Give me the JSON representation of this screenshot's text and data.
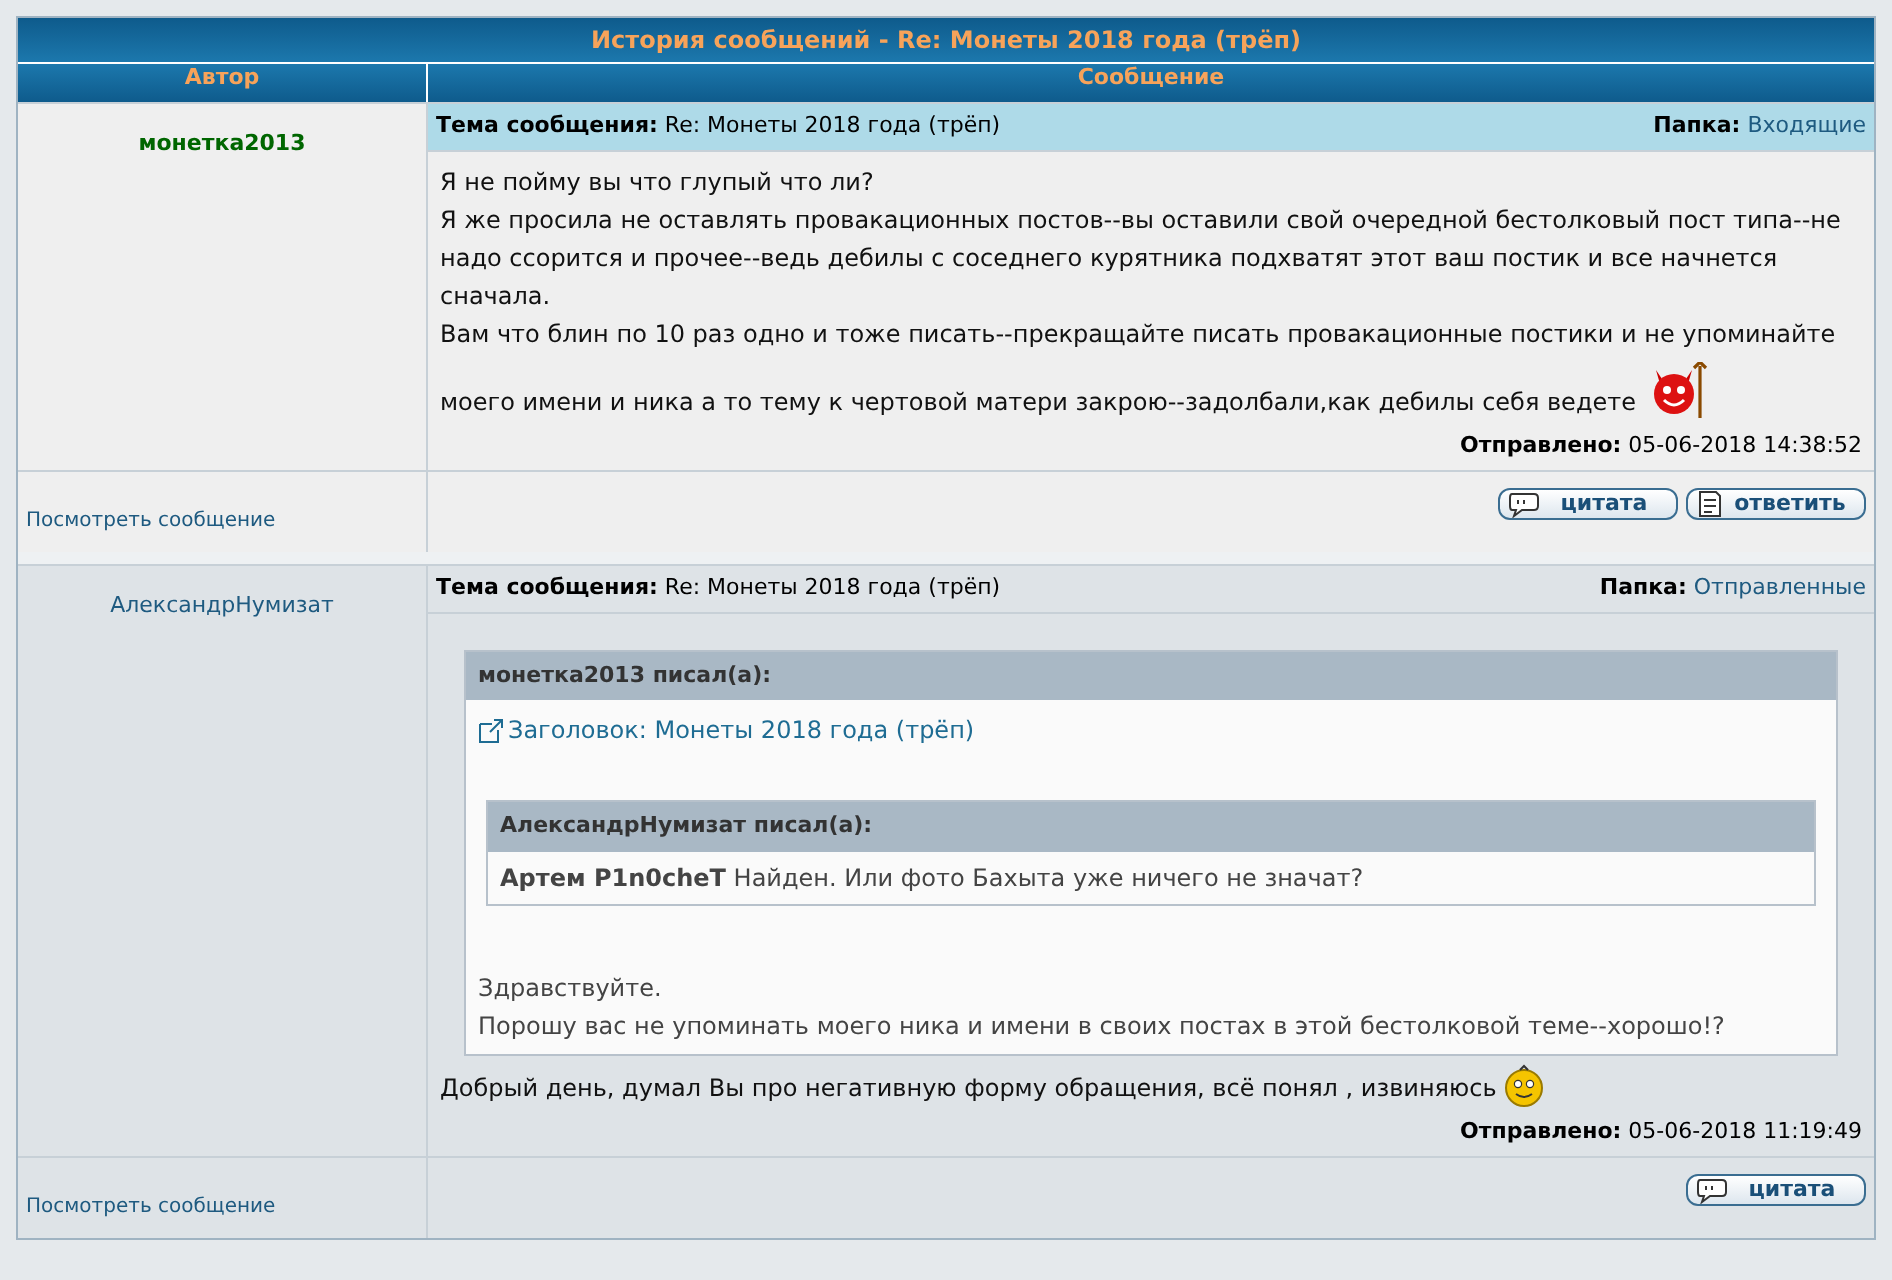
{
  "page": {
    "title": "История сообщений - Re: Монеты 2018 года (трёп)"
  },
  "columns": [
    "Автор",
    "Сообщение"
  ],
  "posts": [
    {
      "author": "монетка2013",
      "highlighted": true,
      "subject_label": "Тема сообщения:",
      "subject": "Re: Монеты 2018 года (трёп)",
      "folder_label": "Папка:",
      "folder": "Входящие",
      "body": [
        {
          "kind": "text",
          "text": "Я не пойму вы что глупый что ли?"
        },
        {
          "kind": "text",
          "text": "Я же просила не оставлять провакационных постов--вы оставили свой очередной бестолковый пост типа--не надо ссорится и прочее--ведь дебилы с соседнего курятника подхватят этот ваш постик и все начнется сначала."
        },
        {
          "kind": "devil",
          "lines": [
            "Вам что блин по 10 раз одно и тоже писать--прекращайте писать провакационные постики и не упоминайте",
            "моего имени и ника а то тему к чертовой матери закрою--задолбали,как дебилы себя ведете"
          ]
        }
      ],
      "sent_label": "Отправлено:",
      "sent": "05-06-2018 14:38:52",
      "view_link": "Посмотреть сообщение",
      "buttons": [
        "цитата",
        "ответить"
      ]
    },
    {
      "author": "АлександрНумизат",
      "highlighted": false,
      "subject_label": "Тема сообщения:",
      "subject": "Re: Монеты 2018 года (трёп)",
      "folder_label": "Папка:",
      "folder": "Отправленные",
      "body": [
        {
          "kind": "quote",
          "header": "монетка2013 писал(а):",
          "link": "Заголовок: Монеты 2018 года (трёп)",
          "nested": {
            "header": "АлександрНумизат писал(а):",
            "text": "**Артем P1n0cheT** Найден. Или фото Бахыта уже ничего не значат?"
          },
          "lines": [
            "Здравствуйте.",
            "Порошу вас не упоминать моего ника и имени в своих постах в этой бестолковой теме--хорошо!?"
          ]
        },
        {
          "kind": "smiley",
          "lines": [
            "Добрый день, думал Вы про негативную форму обращения, всё понял , извиняюсь"
          ]
        }
      ],
      "sent_label": "Отправлено:",
      "sent": "05-06-2018 11:19:49",
      "view_link": "Посмотреть сообщение",
      "buttons": [
        "цитата"
      ]
    }
  ]
}
